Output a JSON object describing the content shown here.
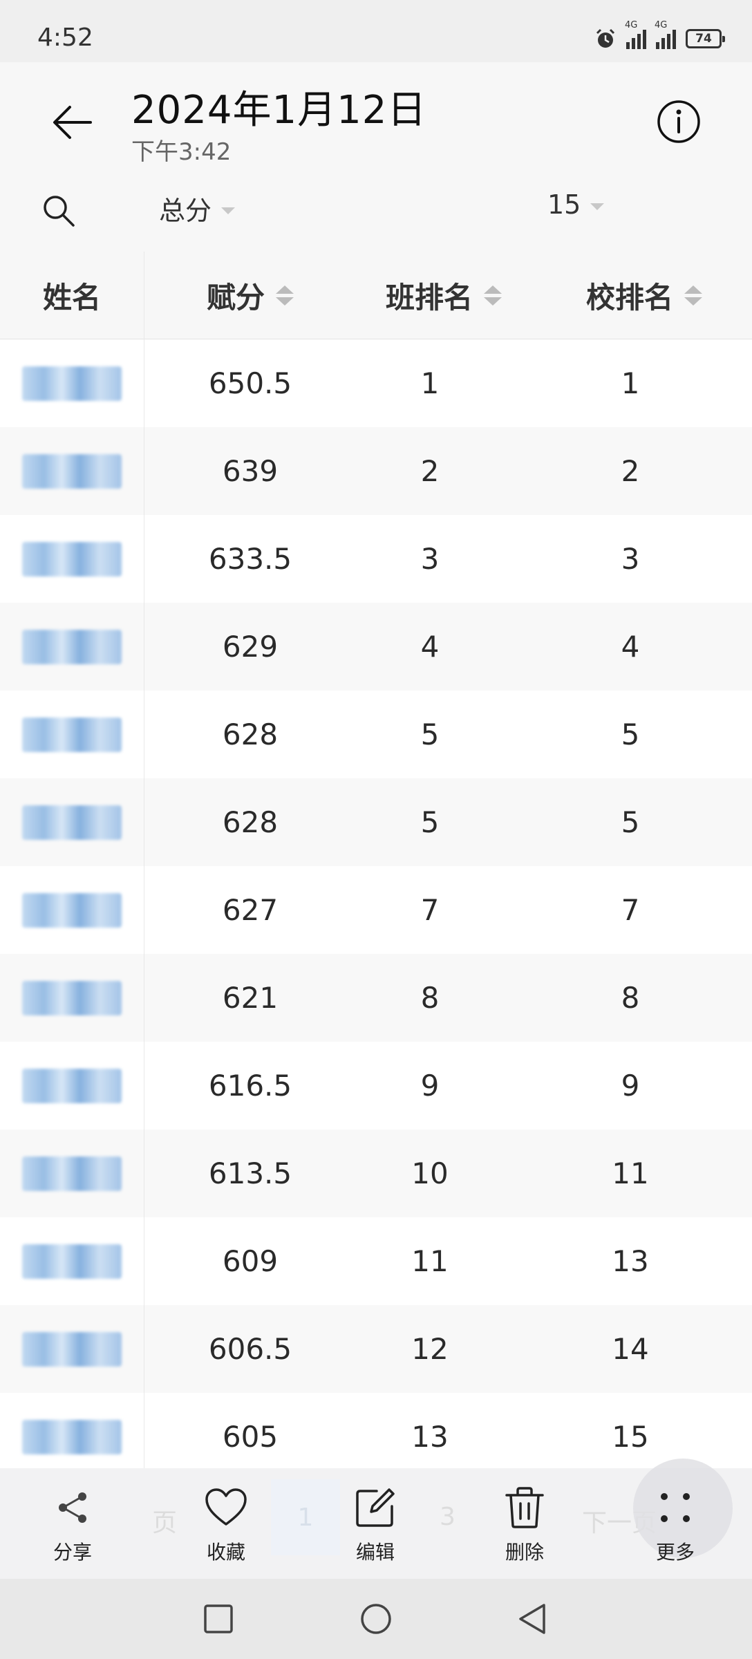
{
  "status_bar": {
    "time": "4:52",
    "signal1": "4G",
    "signal2": "4G",
    "battery": "74"
  },
  "header": {
    "title": "2024年1月12日",
    "subtitle": "下午3:42"
  },
  "filters": {
    "subject": "总分",
    "count": "15"
  },
  "table": {
    "columns": [
      "姓名",
      "赋分",
      "班排名",
      "校排名"
    ],
    "rows": [
      {
        "score": "650.5",
        "class_rank": "1",
        "school_rank": "1"
      },
      {
        "score": "639",
        "class_rank": "2",
        "school_rank": "2"
      },
      {
        "score": "633.5",
        "class_rank": "3",
        "school_rank": "3"
      },
      {
        "score": "629",
        "class_rank": "4",
        "school_rank": "4"
      },
      {
        "score": "628",
        "class_rank": "5",
        "school_rank": "5"
      },
      {
        "score": "628",
        "class_rank": "5",
        "school_rank": "5"
      },
      {
        "score": "627",
        "class_rank": "7",
        "school_rank": "7"
      },
      {
        "score": "621",
        "class_rank": "8",
        "school_rank": "8"
      },
      {
        "score": "616.5",
        "class_rank": "9",
        "school_rank": "9"
      },
      {
        "score": "613.5",
        "class_rank": "10",
        "school_rank": "11"
      },
      {
        "score": "609",
        "class_rank": "11",
        "school_rank": "13"
      },
      {
        "score": "606.5",
        "class_rank": "12",
        "school_rank": "14"
      },
      {
        "score": "605",
        "class_rank": "13",
        "school_rank": "15"
      }
    ]
  },
  "pager": {
    "prev": "页",
    "pages": [
      "1",
      "3"
    ],
    "next": "下一页"
  },
  "toolbar": {
    "share": "分享",
    "favorite": "收藏",
    "edit": "编辑",
    "delete": "删除",
    "more": "更多"
  }
}
